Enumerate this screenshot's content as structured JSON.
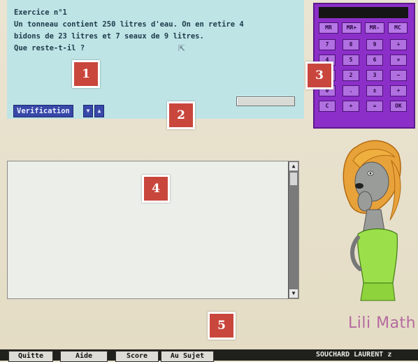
{
  "exercise": {
    "title": "Exercice n°1",
    "line1": "Un tonneau contient 250 litres d'eau. On en retire 4",
    "line2": "bidons de 23 litres et 7 seaux de 9 litres.",
    "question": "Que reste-t-il ?",
    "verify_label": "Verification",
    "down_symbol": "▼",
    "up_symbol": "▲",
    "answer_value": ""
  },
  "calculator": {
    "display_value": "",
    "memory_buttons": [
      "MR",
      "MR+",
      "MR-",
      "MC"
    ],
    "keys": [
      "7",
      "8",
      "9",
      "÷",
      "4",
      "5",
      "6",
      "×",
      "1",
      "2",
      "3",
      "−",
      "0",
      ".",
      "±",
      "+",
      "C",
      "+",
      "=",
      "OK"
    ]
  },
  "workspace": {
    "content": "",
    "scroll_up": "▲",
    "scroll_down": "▼"
  },
  "brand": {
    "name": "Lili Math"
  },
  "bottom_bar": {
    "buttons": [
      "Quitte",
      "Aide",
      "Score",
      "Au Sujet"
    ],
    "user": "SOUCHARD LAURENT z"
  },
  "callouts": [
    "1",
    "2",
    "3",
    "4",
    "5"
  ],
  "colors": {
    "exercise_bg": "#bfe4e6",
    "calculator": "#8c2fc9",
    "callout": "#c9463c",
    "brand": "#b56aa0"
  }
}
